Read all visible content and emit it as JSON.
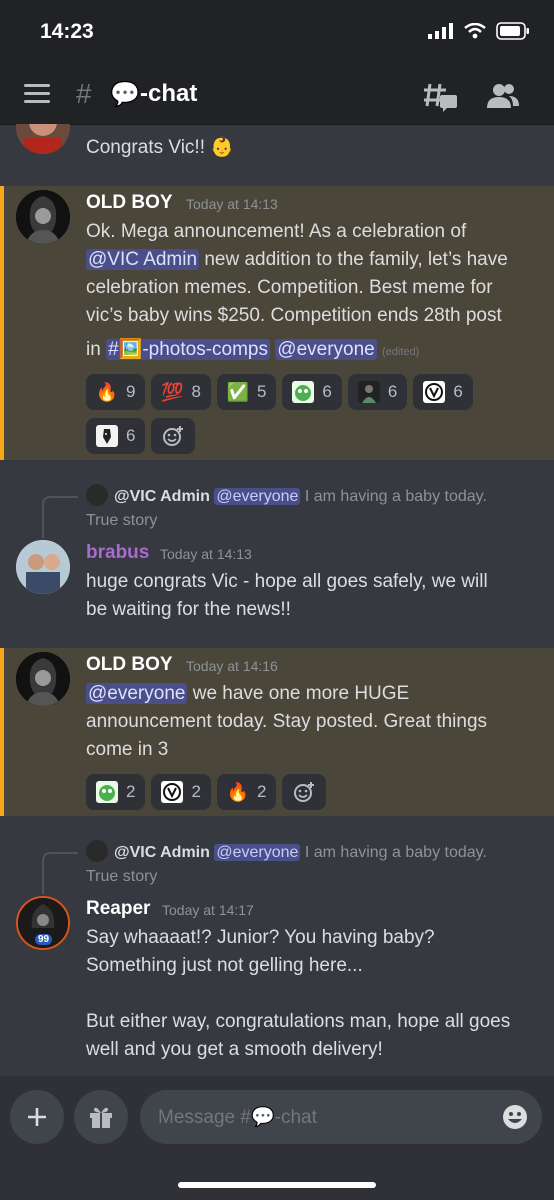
{
  "status_bar": {
    "time": "14:23"
  },
  "header": {
    "hash": "#",
    "channel_emoji": "💬",
    "channel_name": "-chat"
  },
  "messages": [
    {
      "text": "Congrats Vic!! 👶"
    },
    {
      "author": "OLD BOY",
      "timestamp": "Today at 14:13",
      "line1": "Ok. Mega announcement! As a celebration of",
      "mention1": "@VIC Admin",
      "line2_rest": " new addition to the family, let’s have",
      "line3": "celebration memes. Competition. Best meme for",
      "line4": "vic’s baby wins $250. Competition ends 28th post",
      "line5_pre": "in ",
      "channel_mention_hash": "#",
      "channel_mention_emoji": "🖼️",
      "channel_mention_name": "-photos-comps",
      "mention2": "@everyone",
      "edited": "(edited)",
      "reactions": [
        {
          "emoji": "🔥",
          "count": "9"
        },
        {
          "emoji": "💯",
          "count": "8"
        },
        {
          "emoji": "✅",
          "count": "5"
        },
        {
          "emoji": "pepe-icon",
          "count": "6"
        },
        {
          "emoji": "dark-figure-icon",
          "count": "6"
        },
        {
          "emoji": "v-logo-icon",
          "count": "6"
        },
        {
          "emoji": "dog-icon",
          "count": "6"
        }
      ]
    },
    {
      "reply": {
        "author": "@VIC Admin",
        "mention": "@everyone",
        "text": " I am having a baby today.",
        "text2": "True story"
      },
      "author": "brabus",
      "timestamp": "Today at 14:13",
      "line1": "huge congrats Vic -  hope all goes safely, we will",
      "line2": "be waiting for the news!!"
    },
    {
      "author": "OLD BOY",
      "timestamp": "Today at 14:16",
      "mention": "@everyone",
      "line1_rest": " we have one more HUGE",
      "line2": "announcement today. Stay posted. Great things",
      "line3": "come in 3",
      "reactions": [
        {
          "emoji": "pepe-icon",
          "count": "2"
        },
        {
          "emoji": "v-logo-icon",
          "count": "2"
        },
        {
          "emoji": "🔥",
          "count": "2"
        }
      ]
    },
    {
      "reply": {
        "author": "@VIC Admin",
        "mention": "@everyone",
        "text": " I am having a baby today.",
        "text2": "True story"
      },
      "author": "Reaper",
      "timestamp": "Today at 14:17",
      "avatar_badge": "99",
      "line1": "Say whaaaat!? Junior? You having baby?",
      "line2": "Something just not gelling here...",
      "line3": "But either way, congratulations man, hope all goes",
      "line4": "well and you get a smooth delivery!"
    }
  ],
  "composer": {
    "placeholder_pre": "Message #",
    "placeholder_emoji": "💬",
    "placeholder_post": "-chat"
  },
  "colors": {
    "background": "#36393f",
    "highlight": "#4a463a",
    "highlight_bar": "#faa61a",
    "mention": "#4a4f8a",
    "brabus_name": "#a96ad1"
  }
}
